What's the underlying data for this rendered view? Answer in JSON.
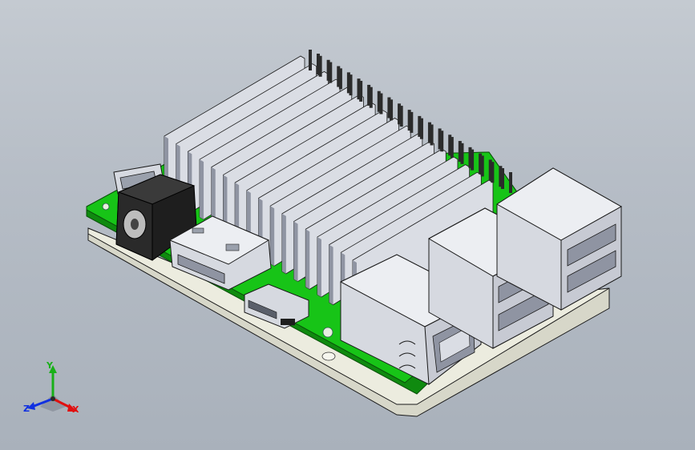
{
  "viewport": {
    "colors": {
      "background": "#b7bec7",
      "pcb_green": "#17c417",
      "pcb_edge": "#0f8a0f",
      "base_plate": "#ececdf",
      "metal": "#dadde4",
      "metal_shadow": "#8f94a2",
      "connector_black": "#1e1e1e",
      "pins": "#2b2b2b",
      "edge_line": "#1a1a1a"
    }
  },
  "model": {
    "board_name": "",
    "parts": [
      "base-plate",
      "pcb",
      "heatsink",
      "gpio-header",
      "dc-power-jack",
      "hdmi-port",
      "micro-usb-port",
      "ethernet-port",
      "usb-port-stack-1",
      "usb-port-stack-2"
    ]
  },
  "triad": {
    "x_label": "X",
    "y_label": "Y",
    "z_label": "Z",
    "colors": {
      "x": "#e01010",
      "y": "#18b018",
      "z": "#1030e0"
    }
  }
}
